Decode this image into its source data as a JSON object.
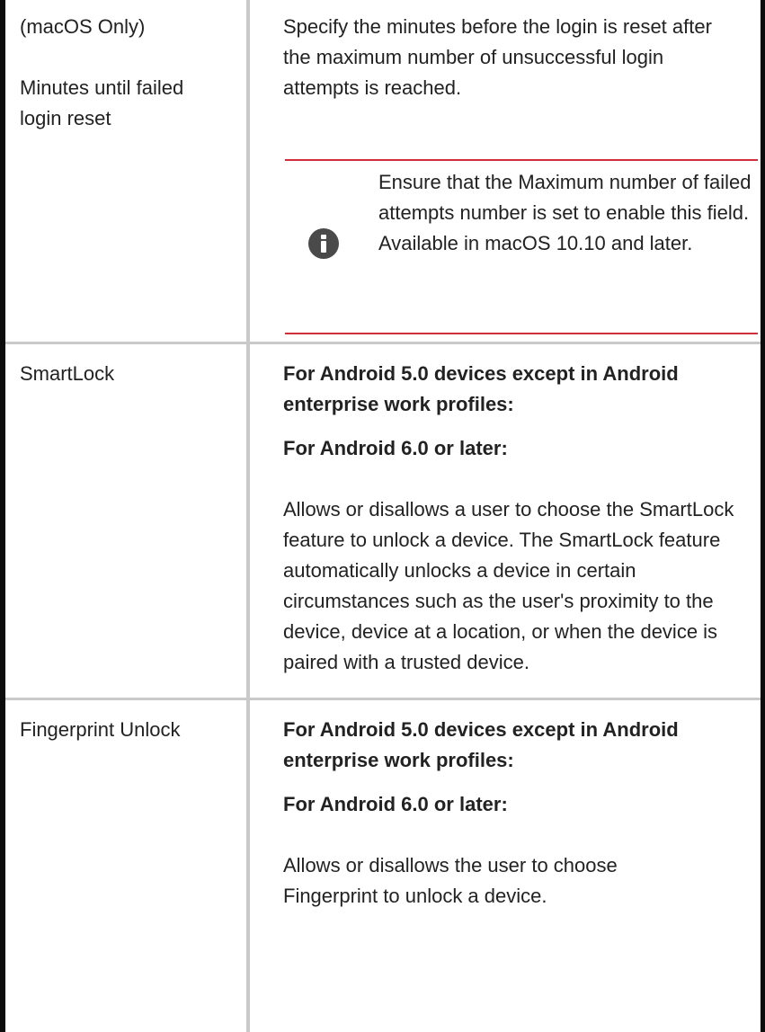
{
  "rows": [
    {
      "setting": [
        "(macOS Only)",
        "Minutes until failed login reset"
      ],
      "description": "Specify the minutes before the login is reset after the maximum number of unsuccessful login attempts is reached.",
      "note": "Ensure that the Maximum number of failed attempts number is set to enable this field. Available in macOS 10.10 and later.",
      "note_icon": "info-icon"
    },
    {
      "setting": "SmartLock",
      "heading1": "For Android 5.0 devices except in Android enterprise work profiles:",
      "heading2": "For Android 6.0 or later:",
      "description": "Allows or disallows a user to choose the SmartLock feature to unlock a device. The SmartLock feature automatically unlocks a device in certain circumstances such as the user's proximity to the device, device at a location, or when the device is paired with a trusted device."
    },
    {
      "setting": "Fingerprint Unlock",
      "heading1": "For Android 5.0 devices except in Android enterprise work profiles:",
      "heading2": "For Android 6.0 or later:",
      "description": "Allows or disallows the user to choose Fingerprint to unlock a device."
    }
  ],
  "colors": {
    "note_border": "#d02e3a",
    "grid": "#c9c9c9",
    "outer_border": "#0c0c0c",
    "icon": "#4a4a4a"
  }
}
